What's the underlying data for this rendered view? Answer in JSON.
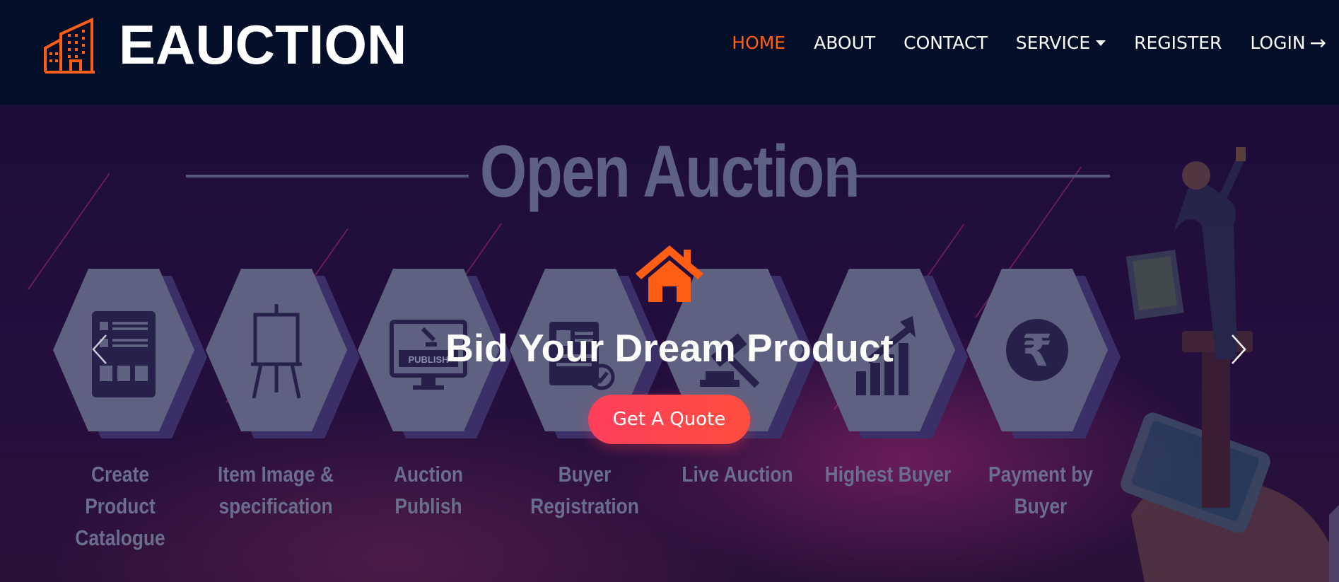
{
  "brand": {
    "name": "EAUCTION",
    "logo_icon": "building-icon",
    "accent": "#ff5e14"
  },
  "nav": {
    "items": [
      {
        "label": "HOME",
        "active": true
      },
      {
        "label": "ABOUT"
      },
      {
        "label": "CONTACT"
      },
      {
        "label": "SERVICE",
        "icon": "caret-down-icon"
      },
      {
        "label": "REGISTER"
      },
      {
        "label": "LOGIN",
        "icon": "arrow-right-icon",
        "icon_glyph": "→"
      }
    ]
  },
  "hero": {
    "banner_title": "Open Auction",
    "steps": [
      {
        "label": "Create Product Catalogue",
        "icon": "catalogue-icon"
      },
      {
        "label": "Item Image & specification",
        "icon": "easel-icon"
      },
      {
        "label": "Auction Publish",
        "icon": "publish-monitor-icon",
        "icon_text": "PUBLISH"
      },
      {
        "label": "Buyer Registration",
        "icon": "registration-form-icon"
      },
      {
        "label": "Live Auction",
        "icon": "gavel-icon"
      },
      {
        "label": "Highest Buyer",
        "icon": "growth-chart-icon"
      },
      {
        "label": "Payment by Buyer",
        "icon": "rupee-icon",
        "icon_text": "₹"
      }
    ],
    "heading": "Bid Your Dream Product",
    "cta_label": "Get A Quote",
    "home_icon": "home-icon",
    "prev_icon": "chevron-left-icon",
    "next_icon": "chevron-right-icon"
  },
  "colors": {
    "navbar_bg": "#030e29",
    "accent": "#ff5e14",
    "cta_gradient_start": "#fe3f5c",
    "cta_gradient_end": "#ff4d3e"
  }
}
